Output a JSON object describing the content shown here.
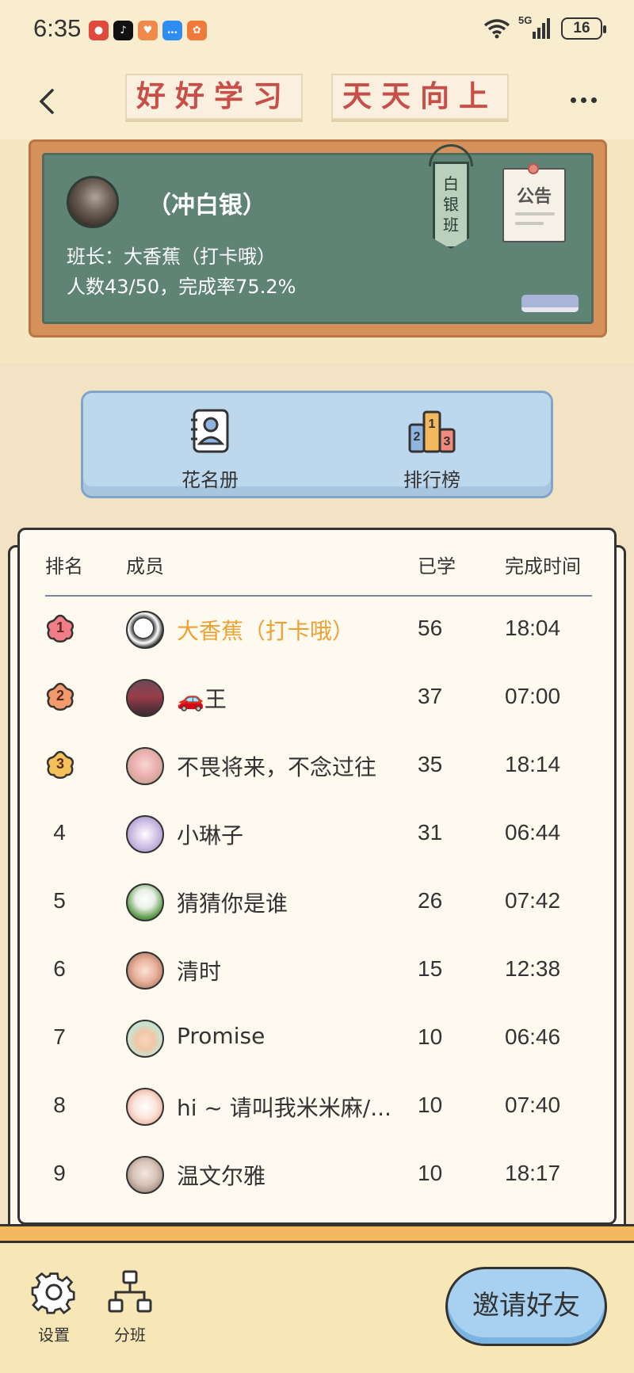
{
  "status_bar": {
    "time": "6:35",
    "network": "5G",
    "battery": "16",
    "app_icons": [
      "message-app-icon",
      "tiktok-icon",
      "health-app-icon",
      "chat-app-icon",
      "store-app-icon"
    ]
  },
  "header": {
    "title_left": "好好学习",
    "title_right": "天天向上"
  },
  "board": {
    "class_name": "（冲白银）",
    "monitor": "班长：大香蕉（打卡哦）",
    "stats": "人数43/50，完成率75.2%",
    "banner": [
      "白",
      "银",
      "班"
    ],
    "notice": "公告"
  },
  "tabs": {
    "roster": "花名册",
    "ranking": "排行榜"
  },
  "list": {
    "headers": {
      "rank": "排名",
      "member": "成员",
      "learned": "已学",
      "time": "完成时间"
    },
    "rows": [
      {
        "rank": "1",
        "name": "大香蕉（打卡哦）",
        "learned": "56",
        "time": "18:04"
      },
      {
        "rank": "2",
        "name": "🚗王",
        "learned": "37",
        "time": "07:00"
      },
      {
        "rank": "3",
        "name": "不畏将来，不念过往",
        "learned": "35",
        "time": "18:14"
      },
      {
        "rank": "4",
        "name": "小琳子",
        "learned": "31",
        "time": "06:44"
      },
      {
        "rank": "5",
        "name": "猜猜你是谁",
        "learned": "26",
        "time": "07:42"
      },
      {
        "rank": "6",
        "name": "清时",
        "learned": "15",
        "time": "12:38"
      },
      {
        "rank": "7",
        "name": "Promise",
        "learned": "10",
        "time": "06:46"
      },
      {
        "rank": "8",
        "name": "hi ~ 请叫我米米麻/...",
        "learned": "10",
        "time": "07:40"
      },
      {
        "rank": "9",
        "name": "温文尔雅",
        "learned": "10",
        "time": "18:17"
      }
    ]
  },
  "bottom": {
    "settings": "设置",
    "split_class": "分班",
    "invite": "邀请好友"
  },
  "colors": {
    "background": "#f1e3c4",
    "title_red": "#c64f48",
    "chalkboard": "#5f8374",
    "gold_name": "#eca233",
    "invite_button": "#a7d0f1"
  }
}
